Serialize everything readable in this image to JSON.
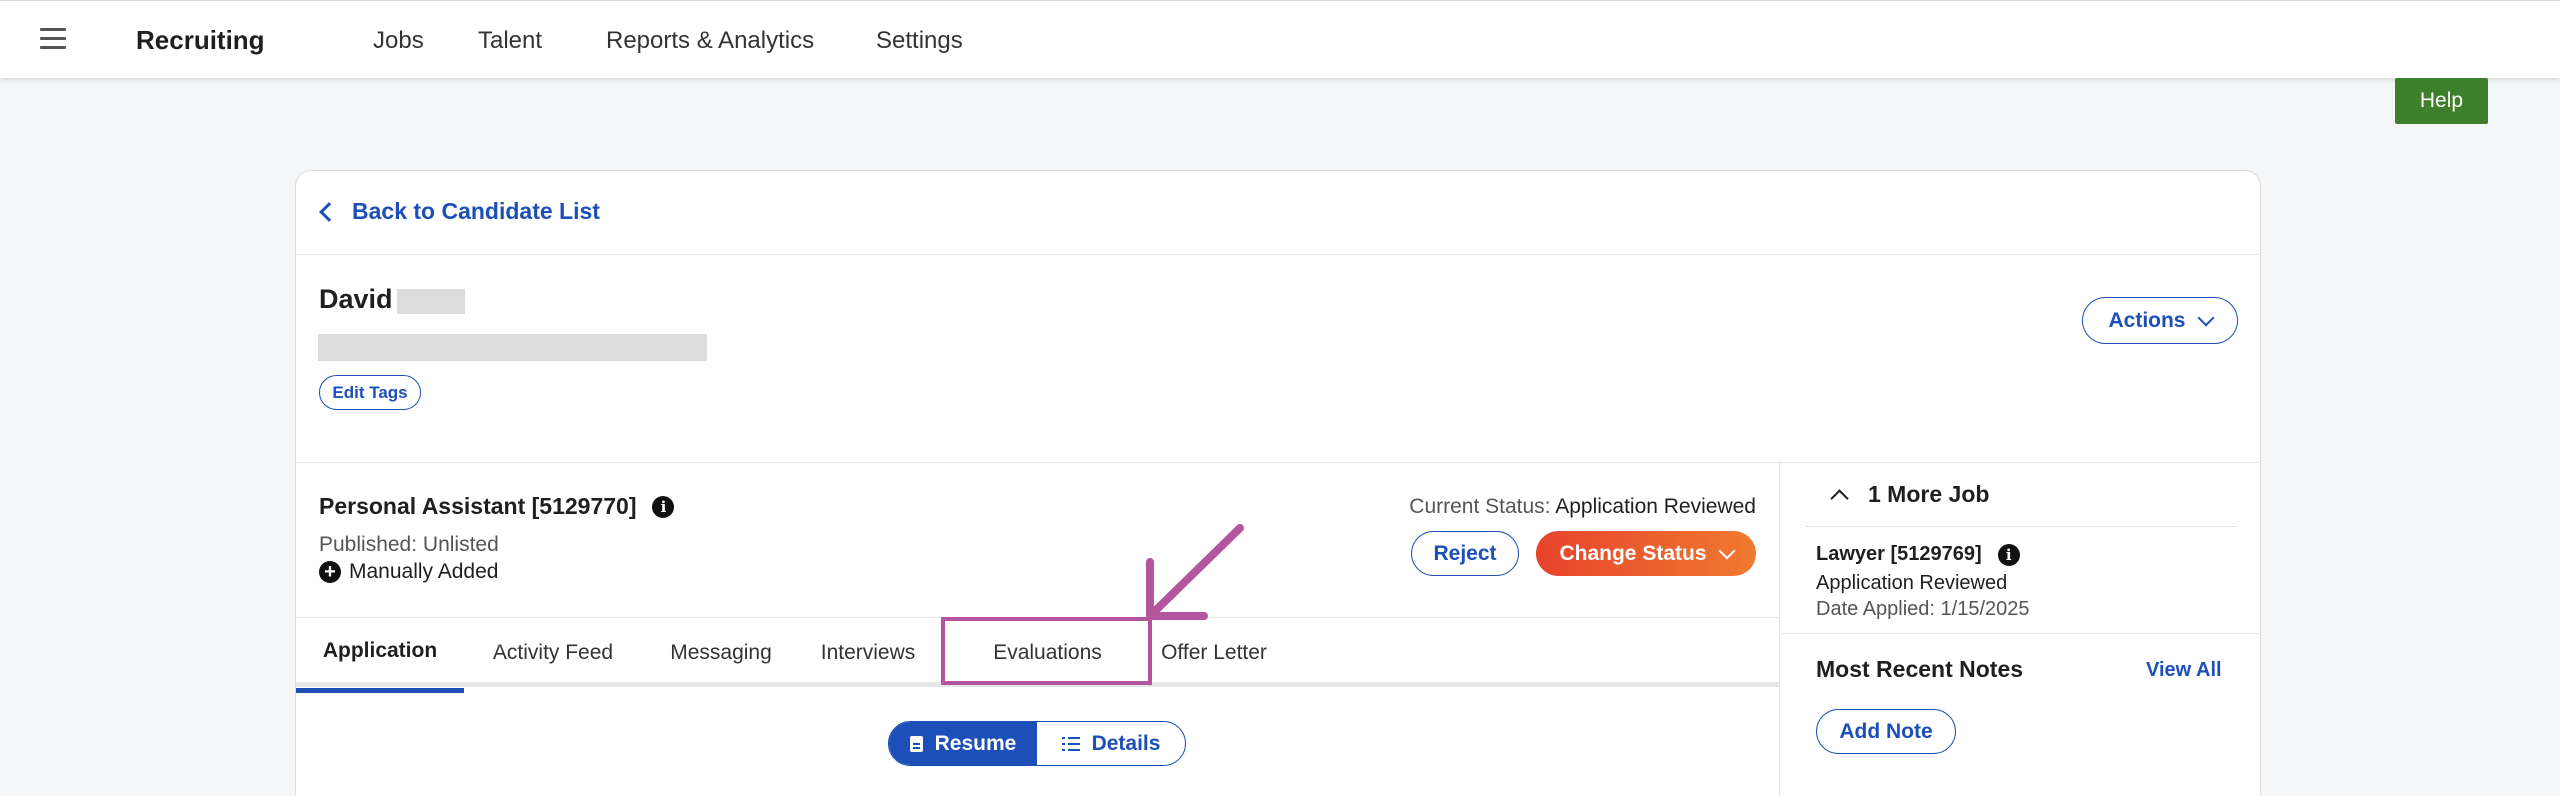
{
  "topbar": {
    "brand": "Recruiting",
    "nav": [
      "Jobs",
      "Talent",
      "Reports & Analytics",
      "Settings"
    ],
    "menu_icon": "hamburger-icon"
  },
  "help": {
    "label": "Help",
    "color": "#3d7f2a"
  },
  "back": {
    "label": "Back to Candidate List"
  },
  "candidate": {
    "first_name": "David",
    "edit_tags_label": "Edit Tags",
    "actions_label": "Actions"
  },
  "job": {
    "title": "Personal Assistant [5129770]",
    "published": "Published: Unlisted",
    "source": "Manually Added",
    "status_label": "Current Status:",
    "status_value": "Application Reviewed",
    "reject_label": "Reject",
    "change_status_label": "Change Status"
  },
  "tabs": [
    {
      "label": "Application",
      "active": true
    },
    {
      "label": "Activity Feed",
      "active": false
    },
    {
      "label": "Messaging",
      "active": false
    },
    {
      "label": "Interviews",
      "active": false
    },
    {
      "label": "Evaluations",
      "active": false
    },
    {
      "label": "Offer Letter",
      "active": false
    }
  ],
  "view_toggle": {
    "resume_label": "Resume",
    "details_label": "Details",
    "selected": "Resume"
  },
  "side": {
    "more_jobs_label": "1 More Job",
    "other_job_title": "Lawyer [5129769]",
    "other_job_status": "Application Reviewed",
    "other_job_date": "Date Applied: 1/15/2025",
    "notes_title": "Most Recent Notes",
    "view_all_label": "View All",
    "add_note_label": "Add Note"
  },
  "colors": {
    "accent": "#1d4fb8",
    "annotation": "#b3569e",
    "change_status_start": "#e8432d",
    "change_status_end": "#f07a2f"
  }
}
